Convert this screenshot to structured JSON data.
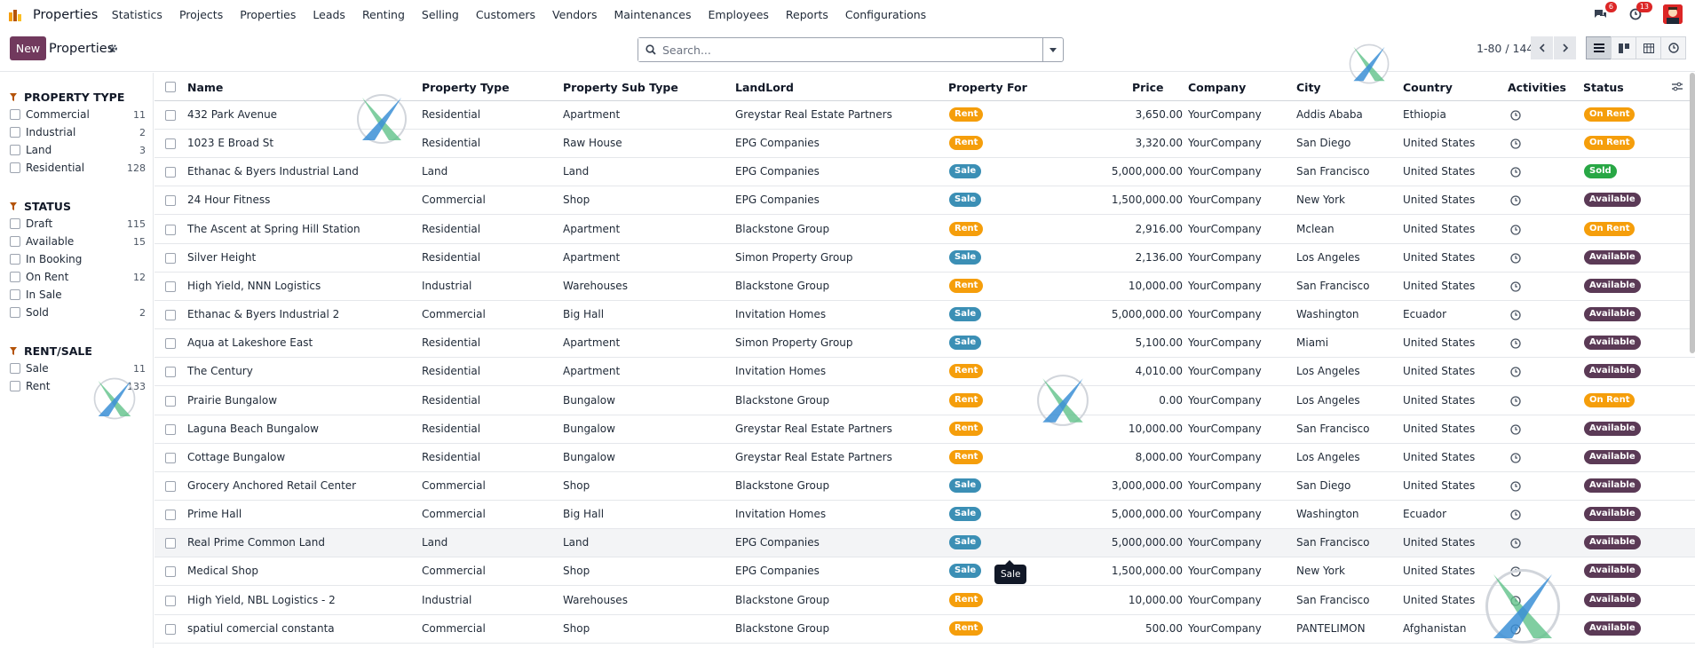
{
  "navbar": {
    "app_name": "Properties",
    "menu": [
      "Statistics",
      "Projects",
      "Properties",
      "Leads",
      "Renting",
      "Selling",
      "Customers",
      "Vendors",
      "Maintenances",
      "Employees",
      "Reports",
      "Configurations"
    ],
    "messages_count": "6",
    "activities_count": "13"
  },
  "control_panel": {
    "new_label": "New",
    "title": "Properties",
    "search_placeholder": "Search...",
    "pager": "1-80 / 144"
  },
  "sidebar": {
    "sections": [
      {
        "title": "PROPERTY TYPE",
        "items": [
          {
            "label": "Commercial",
            "count": "11"
          },
          {
            "label": "Industrial",
            "count": "2"
          },
          {
            "label": "Land",
            "count": "3"
          },
          {
            "label": "Residential",
            "count": "128"
          }
        ]
      },
      {
        "title": "STATUS",
        "items": [
          {
            "label": "Draft",
            "count": "115"
          },
          {
            "label": "Available",
            "count": "15"
          },
          {
            "label": "In Booking",
            "count": ""
          },
          {
            "label": "On Rent",
            "count": "12"
          },
          {
            "label": "In Sale",
            "count": ""
          },
          {
            "label": "Sold",
            "count": "2"
          }
        ]
      },
      {
        "title": "RENT/SALE",
        "items": [
          {
            "label": "Sale",
            "count": "11"
          },
          {
            "label": "Rent",
            "count": "133"
          }
        ]
      }
    ]
  },
  "table": {
    "columns": [
      "Name",
      "Property Type",
      "Property Sub Type",
      "LandLord",
      "Property For",
      "Price",
      "Company",
      "City",
      "Country",
      "Activities",
      "Status"
    ],
    "rows": [
      {
        "name": "432 Park Avenue",
        "type": "Residential",
        "subtype": "Apartment",
        "landlord": "Greystar Real Estate Partners",
        "for": "Rent",
        "price": "3,650.00",
        "company": "YourCompany",
        "city": "Addis Ababa",
        "country": "Ethiopia",
        "status": "On Rent"
      },
      {
        "name": "1023 E Broad St",
        "type": "Residential",
        "subtype": "Raw House",
        "landlord": "EPG Companies",
        "for": "Rent",
        "price": "3,320.00",
        "company": "YourCompany",
        "city": "San Diego",
        "country": "United States",
        "status": "On Rent"
      },
      {
        "name": "Ethanac & Byers Industrial Land",
        "type": "Land",
        "subtype": "Land",
        "landlord": "EPG Companies",
        "for": "Sale",
        "price": "5,000,000.00",
        "company": "YourCompany",
        "city": "San Francisco",
        "country": "United States",
        "status": "Sold"
      },
      {
        "name": "24 Hour Fitness",
        "type": "Commercial",
        "subtype": "Shop",
        "landlord": "EPG Companies",
        "for": "Sale",
        "price": "1,500,000.00",
        "company": "YourCompany",
        "city": "New York",
        "country": "United States",
        "status": "Available"
      },
      {
        "name": "The Ascent at Spring Hill Station",
        "type": "Residential",
        "subtype": "Apartment",
        "landlord": "Blackstone Group",
        "for": "Rent",
        "price": "2,916.00",
        "company": "YourCompany",
        "city": "Mclean",
        "country": "United States",
        "status": "On Rent"
      },
      {
        "name": "Silver Height",
        "type": "Residential",
        "subtype": "Apartment",
        "landlord": "Simon Property Group",
        "for": "Sale",
        "price": "2,136.00",
        "company": "YourCompany",
        "city": "Los Angeles",
        "country": "United States",
        "status": "Available"
      },
      {
        "name": "High Yield, NNN Logistics",
        "type": "Industrial",
        "subtype": "Warehouses",
        "landlord": "Blackstone Group",
        "for": "Rent",
        "price": "10,000.00",
        "company": "YourCompany",
        "city": "San Francisco",
        "country": "United States",
        "status": "Available"
      },
      {
        "name": "Ethanac & Byers Industrial 2",
        "type": "Commercial",
        "subtype": "Big Hall",
        "landlord": "Invitation Homes",
        "for": "Sale",
        "price": "5,000,000.00",
        "company": "YourCompany",
        "city": "Washington",
        "country": "Ecuador",
        "status": "Available"
      },
      {
        "name": "Aqua at Lakeshore East",
        "type": "Residential",
        "subtype": "Apartment",
        "landlord": "Simon Property Group",
        "for": "Sale",
        "price": "5,100.00",
        "company": "YourCompany",
        "city": "Miami",
        "country": "United States",
        "status": "Available"
      },
      {
        "name": "The Century",
        "type": "Residential",
        "subtype": "Apartment",
        "landlord": "Invitation Homes",
        "for": "Rent",
        "price": "4,010.00",
        "company": "YourCompany",
        "city": "Los Angeles",
        "country": "United States",
        "status": "Available"
      },
      {
        "name": "Prairie Bungalow",
        "type": "Residential",
        "subtype": "Bungalow",
        "landlord": "Blackstone Group",
        "for": "Rent",
        "price": "0.00",
        "company": "YourCompany",
        "city": "Los Angeles",
        "country": "United States",
        "status": "On Rent"
      },
      {
        "name": "Laguna Beach Bungalow",
        "type": "Residential",
        "subtype": "Bungalow",
        "landlord": "Greystar Real Estate Partners",
        "for": "Rent",
        "price": "10,000.00",
        "company": "YourCompany",
        "city": "San Francisco",
        "country": "United States",
        "status": "Available"
      },
      {
        "name": "Cottage Bungalow",
        "type": "Residential",
        "subtype": "Bungalow",
        "landlord": "Greystar Real Estate Partners",
        "for": "Rent",
        "price": "8,000.00",
        "company": "YourCompany",
        "city": "Los Angeles",
        "country": "United States",
        "status": "Available"
      },
      {
        "name": "Grocery Anchored Retail Center",
        "type": "Commercial",
        "subtype": "Shop",
        "landlord": "Blackstone Group",
        "for": "Sale",
        "price": "3,000,000.00",
        "company": "YourCompany",
        "city": "San Diego",
        "country": "United States",
        "status": "Available"
      },
      {
        "name": "Prime Hall",
        "type": "Commercial",
        "subtype": "Big Hall",
        "landlord": "Invitation Homes",
        "for": "Sale",
        "price": "5,000,000.00",
        "company": "YourCompany",
        "city": "Washington",
        "country": "Ecuador",
        "status": "Available"
      },
      {
        "name": "Real Prime Common Land",
        "type": "Land",
        "subtype": "Land",
        "landlord": "EPG Companies",
        "for": "Sale",
        "price": "5,000,000.00",
        "company": "YourCompany",
        "city": "San Francisco",
        "country": "United States",
        "status": "Available"
      },
      {
        "name": "Medical Shop",
        "type": "Commercial",
        "subtype": "Shop",
        "landlord": "EPG Companies",
        "for": "Sale",
        "price": "1,500,000.00",
        "company": "YourCompany",
        "city": "New York",
        "country": "United States",
        "status": "Available"
      },
      {
        "name": "High Yield, NBL Logistics - 2",
        "type": "Industrial",
        "subtype": "Warehouses",
        "landlord": "Blackstone Group",
        "for": "Rent",
        "price": "10,000.00",
        "company": "YourCompany",
        "city": "San Francisco",
        "country": "United States",
        "status": "Available"
      },
      {
        "name": "spatiul comercial constanta",
        "type": "Commercial",
        "subtype": "Shop",
        "landlord": "Blackstone Group",
        "for": "Rent",
        "price": "500.00",
        "company": "YourCompany",
        "city": "PANTELIMON",
        "country": "Afghanistan",
        "status": "Available"
      }
    ]
  },
  "tooltip": {
    "text": "Sale"
  },
  "colors": {
    "brand": "#71395d",
    "rent_badge": "#f59e0b",
    "sale_badge": "#3b8fb5",
    "on_rent_status": "#f59e0b",
    "sold_status": "#28a745",
    "available_status": "#5b3a56"
  }
}
